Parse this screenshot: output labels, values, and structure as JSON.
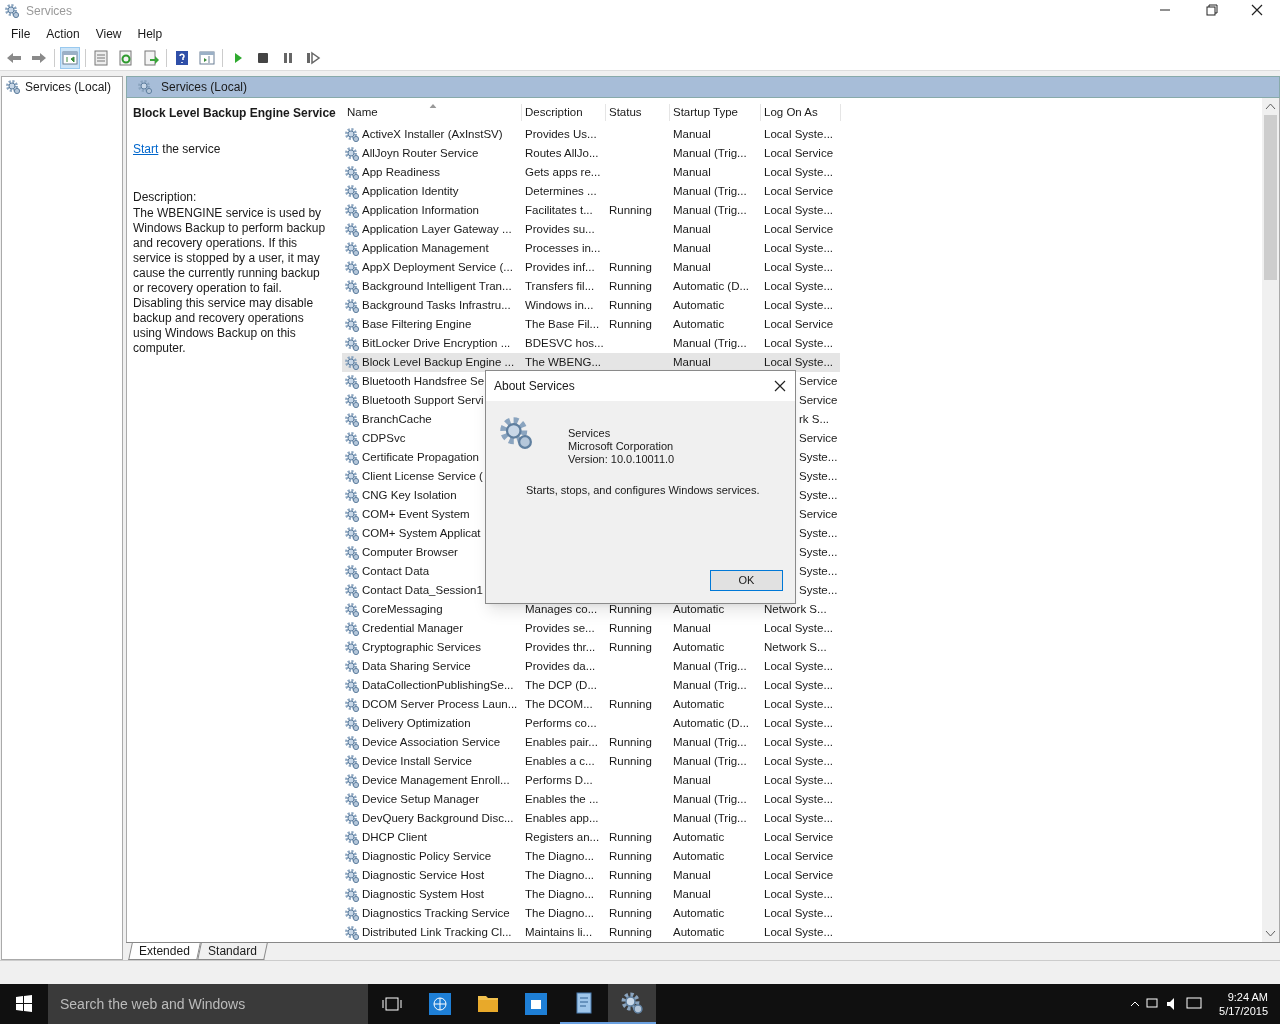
{
  "window": {
    "title": "Services"
  },
  "menu": [
    "File",
    "Action",
    "View",
    "Help"
  ],
  "toolbar": [
    {
      "kind": "back",
      "selected": false
    },
    {
      "kind": "forward",
      "selected": false
    },
    {
      "kind": "sep"
    },
    {
      "kind": "tree",
      "selected": true
    },
    {
      "kind": "sep"
    },
    {
      "kind": "properties",
      "selected": false
    },
    {
      "kind": "refresh",
      "selected": false
    },
    {
      "kind": "export",
      "selected": false
    },
    {
      "kind": "sep"
    },
    {
      "kind": "help",
      "selected": false
    },
    {
      "kind": "actionpane",
      "selected": false
    },
    {
      "kind": "sep"
    },
    {
      "kind": "play",
      "selected": false
    },
    {
      "kind": "stop",
      "selected": false
    },
    {
      "kind": "pause",
      "selected": false
    },
    {
      "kind": "resume",
      "selected": false
    }
  ],
  "tree": {
    "label": "Services (Local)"
  },
  "pane_header": "Services (Local)",
  "details": {
    "title": "Block Level Backup Engine Service",
    "link": "Start",
    "link_rest": "the service",
    "description_label": "Description:",
    "description": "The WBENGINE service is used by Windows Backup to perform backup and recovery operations. If this service is stopped by a user, it may cause the currently running backup or recovery operation to fail. Disabling this service may disable backup and recovery operations using Windows Backup on this computer."
  },
  "table": {
    "columns": [
      {
        "label": "Name",
        "sorted": true
      },
      {
        "label": "Description",
        "sorted": false
      },
      {
        "label": "Status",
        "sorted": false
      },
      {
        "label": "Startup Type",
        "sorted": false
      },
      {
        "label": "Log On As",
        "sorted": false
      }
    ],
    "rows": [
      {
        "kind": "full",
        "selected": false,
        "name": "ActiveX Installer (AxInstSV)",
        "description": "Provides Us...",
        "startup": "Manual",
        "logon": "Local Syste..."
      },
      {
        "kind": "full",
        "selected": false,
        "name": "AllJoyn Router Service",
        "description": "Routes AllJo...",
        "startup": "Manual (Trig...",
        "logon": "Local Service"
      },
      {
        "kind": "full",
        "selected": false,
        "name": "App Readiness",
        "description": "Gets apps re...",
        "startup": "Manual",
        "logon": "Local Syste..."
      },
      {
        "kind": "full",
        "selected": false,
        "name": "Application Identity",
        "description": "Determines ...",
        "startup": "Manual (Trig...",
        "logon": "Local Service"
      },
      {
        "kind": "full",
        "selected": false,
        "name": "Application Information",
        "description": "Facilitates t...",
        "status": "Running",
        "startup": "Manual (Trig...",
        "logon": "Local Syste..."
      },
      {
        "kind": "full",
        "selected": false,
        "name": "Application Layer Gateway ...",
        "description": "Provides su...",
        "startup": "Manual",
        "logon": "Local Service"
      },
      {
        "kind": "full",
        "selected": false,
        "name": "Application Management",
        "description": "Processes in...",
        "startup": "Manual",
        "logon": "Local Syste..."
      },
      {
        "kind": "full",
        "selected": false,
        "name": "AppX Deployment Service (...",
        "description": "Provides inf...",
        "status": "Running",
        "startup": "Manual",
        "logon": "Local Syste..."
      },
      {
        "kind": "full",
        "selected": false,
        "name": "Background Intelligent Tran...",
        "description": "Transfers fil...",
        "status": "Running",
        "startup": "Automatic (D...",
        "logon": "Local Syste..."
      },
      {
        "kind": "full",
        "selected": false,
        "name": "Background Tasks Infrastru...",
        "description": "Windows in...",
        "status": "Running",
        "startup": "Automatic",
        "logon": "Local Syste..."
      },
      {
        "kind": "full",
        "selected": false,
        "name": "Base Filtering Engine",
        "description": "The Base Fil...",
        "status": "Running",
        "startup": "Automatic",
        "logon": "Local Service"
      },
      {
        "kind": "full",
        "selected": false,
        "name": "BitLocker Drive Encryption ...",
        "description": "BDESVC hos...",
        "startup": "Manual (Trig...",
        "logon": "Local Syste..."
      },
      {
        "kind": "full",
        "selected": true,
        "name": "Block Level Backup Engine ...",
        "description": "The WBENG...",
        "startup": "Manual",
        "logon": "Local Syste..."
      },
      {
        "kind": "covered",
        "selected": false,
        "name": "Bluetooth Handsfree Se",
        "logon": "Service"
      },
      {
        "kind": "covered",
        "selected": false,
        "name": "Bluetooth Support Servi",
        "logon": "Service"
      },
      {
        "kind": "covered",
        "selected": false,
        "name": "BranchCache",
        "logon": "rk S..."
      },
      {
        "kind": "covered",
        "selected": false,
        "name": "CDPSvc",
        "logon": "Service"
      },
      {
        "kind": "covered",
        "selected": false,
        "name": "Certificate Propagation",
        "logon": "Syste..."
      },
      {
        "kind": "covered",
        "selected": false,
        "name": "Client License Service (",
        "logon": "Syste..."
      },
      {
        "kind": "covered",
        "selected": false,
        "name": "CNG Key Isolation",
        "logon": "Syste..."
      },
      {
        "kind": "covered",
        "selected": false,
        "name": "COM+ Event System",
        "logon": "Service"
      },
      {
        "kind": "covered",
        "selected": false,
        "name": "COM+ System Applicat",
        "logon": "Syste..."
      },
      {
        "kind": "covered",
        "selected": false,
        "name": "Computer Browser",
        "logon": "Syste..."
      },
      {
        "kind": "covered",
        "selected": false,
        "name": "Contact Data",
        "logon": "Syste..."
      },
      {
        "kind": "covered",
        "selected": false,
        "name": "Contact Data_Session1",
        "logon": "Syste..."
      },
      {
        "kind": "full",
        "selected": false,
        "name": "CoreMessaging",
        "description": "Manages co...",
        "status": "Running",
        "startup": "Automatic",
        "logon": "Network S..."
      },
      {
        "kind": "full",
        "selected": false,
        "name": "Credential Manager",
        "description": "Provides se...",
        "status": "Running",
        "startup": "Manual",
        "logon": "Local Syste..."
      },
      {
        "kind": "full",
        "selected": false,
        "name": "Cryptographic Services",
        "description": "Provides thr...",
        "status": "Running",
        "startup": "Automatic",
        "logon": "Network S..."
      },
      {
        "kind": "full",
        "selected": false,
        "name": "Data Sharing Service",
        "description": "Provides da...",
        "startup": "Manual (Trig...",
        "logon": "Local Syste..."
      },
      {
        "kind": "full",
        "selected": false,
        "name": "DataCollectionPublishingSe...",
        "description": "The DCP (D...",
        "startup": "Manual (Trig...",
        "logon": "Local Syste..."
      },
      {
        "kind": "full",
        "selected": false,
        "name": "DCOM Server Process Laun...",
        "description": "The DCOM...",
        "status": "Running",
        "startup": "Automatic",
        "logon": "Local Syste..."
      },
      {
        "kind": "full",
        "selected": false,
        "name": "Delivery Optimization",
        "description": "Performs co...",
        "startup": "Automatic (D...",
        "logon": "Local Syste..."
      },
      {
        "kind": "full",
        "selected": false,
        "name": "Device Association Service",
        "description": "Enables pair...",
        "status": "Running",
        "startup": "Manual (Trig...",
        "logon": "Local Syste..."
      },
      {
        "kind": "full",
        "selected": false,
        "name": "Device Install Service",
        "description": "Enables a c...",
        "status": "Running",
        "startup": "Manual (Trig...",
        "logon": "Local Syste..."
      },
      {
        "kind": "full",
        "selected": false,
        "name": "Device Management Enroll...",
        "description": "Performs D...",
        "startup": "Manual",
        "logon": "Local Syste..."
      },
      {
        "kind": "full",
        "selected": false,
        "name": "Device Setup Manager",
        "description": "Enables the ...",
        "startup": "Manual (Trig...",
        "logon": "Local Syste..."
      },
      {
        "kind": "full",
        "selected": false,
        "name": "DevQuery Background Disc...",
        "description": "Enables app...",
        "startup": "Manual (Trig...",
        "logon": "Local Syste..."
      },
      {
        "kind": "full",
        "selected": false,
        "name": "DHCP Client",
        "description": "Registers an...",
        "status": "Running",
        "startup": "Automatic",
        "logon": "Local Service"
      },
      {
        "kind": "full",
        "selected": false,
        "name": "Diagnostic Policy Service",
        "description": "The Diagno...",
        "status": "Running",
        "startup": "Automatic",
        "logon": "Local Service"
      },
      {
        "kind": "full",
        "selected": false,
        "name": "Diagnostic Service Host",
        "description": "The Diagno...",
        "status": "Running",
        "startup": "Manual",
        "logon": "Local Service"
      },
      {
        "kind": "full",
        "selected": false,
        "name": "Diagnostic System Host",
        "description": "The Diagno...",
        "status": "Running",
        "startup": "Manual",
        "logon": "Local Syste..."
      },
      {
        "kind": "full",
        "selected": false,
        "name": "Diagnostics Tracking Service",
        "description": "The Diagno...",
        "status": "Running",
        "startup": "Automatic",
        "logon": "Local Syste..."
      },
      {
        "kind": "full",
        "selected": false,
        "name": "Distributed Link Tracking Cl...",
        "description": "Maintains li...",
        "status": "Running",
        "startup": "Automatic",
        "logon": "Local Syste..."
      }
    ]
  },
  "tabs": [
    {
      "label": "Extended",
      "selected": true
    },
    {
      "label": "Standard",
      "selected": false
    }
  ],
  "dialog": {
    "title": "About Services",
    "lines": [
      "Services",
      "Microsoft Corporation",
      "Version: 10.0.10011.0"
    ],
    "text": "Starts, stops, and configures Windows services.",
    "button": "OK"
  },
  "taskbar": {
    "search_placeholder": "Search the web and Windows",
    "time": "9:24 AM",
    "date": "5/17/2015"
  }
}
